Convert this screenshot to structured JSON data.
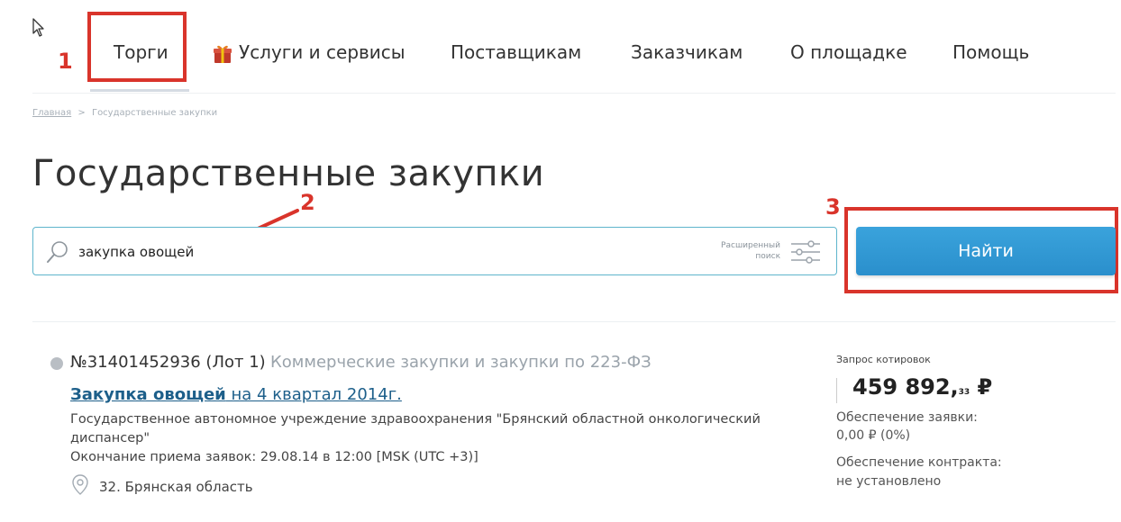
{
  "nav": {
    "items": [
      {
        "label": "Торги"
      },
      {
        "label": "Услуги и сервисы"
      },
      {
        "label": "Поставщикам"
      },
      {
        "label": "Заказчикам"
      },
      {
        "label": "О площадке"
      },
      {
        "label": "Помощь"
      }
    ]
  },
  "annotations": {
    "step1": "1",
    "step2": "2",
    "step3": "3",
    "color": "#d9342b"
  },
  "breadcrumb": {
    "home": "Главная",
    "separator": ">",
    "current": "Государственные закупки"
  },
  "page_title": "Государственные закупки",
  "search": {
    "value": "закупка овощей",
    "advanced_line1": "Расширенный",
    "advanced_line2": "поиск"
  },
  "find_button": {
    "label": "Найти",
    "color": "#3399d6"
  },
  "result": {
    "number": "№31401452936 (Лот 1)",
    "category": "Коммерческие закупки и закупки по 223-ФЗ",
    "title_keyword": "Закупка овощей",
    "title_rest": " на 4 квартал 2014г.",
    "org_line1": "Государственное автономное учреждение здравоохранения \"Брянский областной онкологический",
    "org_line2": "диспансер\"",
    "deadline": "Окончание приема заявок: 29.08.14 в 12:00 [MSK (UTC +3)]",
    "region": "32. Брянская область",
    "procedure_type": "Запрос котировок",
    "price_main": "459 892,",
    "price_kop": "33",
    "price_currency": " ₽",
    "bid_security_label": "Обеспечение заявки:",
    "bid_security_value": "0,00 ₽ (0%)",
    "contract_security_label": "Обеспечение контракта:",
    "contract_security_value": "не установлено"
  }
}
